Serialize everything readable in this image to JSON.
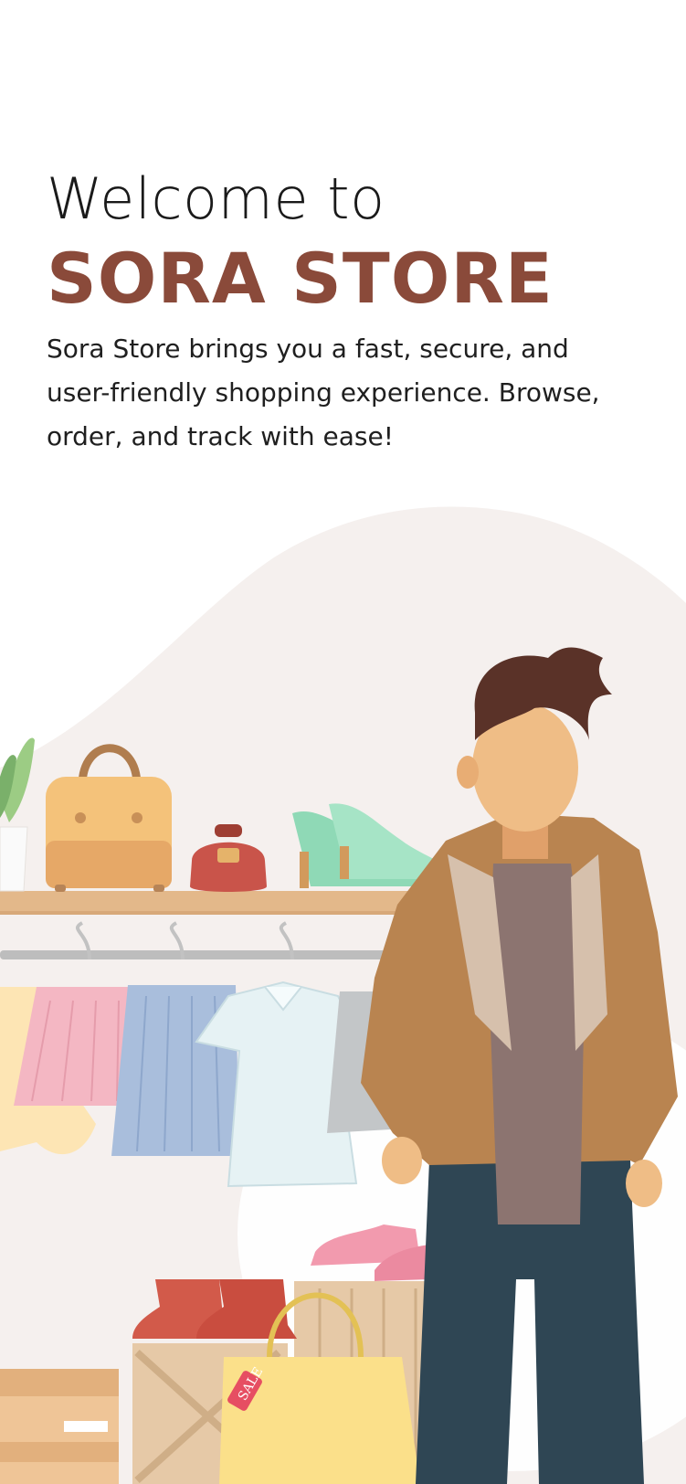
{
  "onboarding": {
    "welcome_line": "Welcome to",
    "brand_name": "SORA STORE",
    "tagline": "Sora Store brings you a fast, secure, and user-friendly shopping experience. Browse, order, and track with ease!"
  },
  "illustration": {
    "sale_tag_text": "SALE",
    "colors": {
      "brand": "#8a4a3a",
      "background_blob": "#f5f0ee",
      "shelf": "#e3b88a",
      "jacket": "#b98450",
      "jeans": "#2f4654",
      "hair": "#5a3228",
      "skin": "#efbd86"
    }
  }
}
